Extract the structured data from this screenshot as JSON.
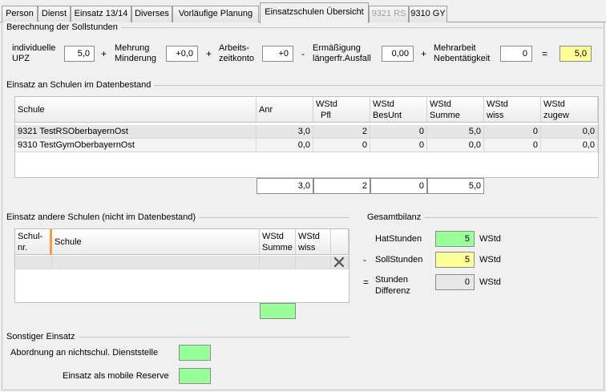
{
  "tabs": [
    {
      "label": "Person"
    },
    {
      "label": "Dienst"
    },
    {
      "label": "Einsatz 13/14"
    },
    {
      "label": "Diverses"
    },
    {
      "label": "Vorläufige Planung"
    },
    {
      "label": "Einsatzschulen Übersicht"
    },
    {
      "label": "9321 RS"
    },
    {
      "label": "9310 GY"
    }
  ],
  "soll": {
    "title": "Berechnung der Sollstunden",
    "upz_label_1": "individuelle",
    "upz_label_2": "UPZ",
    "upz_value": "5,0",
    "plus1": "+",
    "mehrung_label_1": "Mehrung",
    "mehrung_label_2": "Minderung",
    "mehrung_value": "+0,0",
    "plus2": "+",
    "arbeitszeit_label_1": "Arbeits-",
    "arbeitszeit_label_2": "zeitkonto",
    "arbeitszeit_value": "+0",
    "minus": "-",
    "ermaessigung_label_1": "Ermäßigung",
    "ermaessigung_label_2": "längerfr.Ausfall",
    "ermaessigung_value": "0,00",
    "plus3": "+",
    "mehrarbeit_label_1": "Mehrarbeit",
    "mehrarbeit_label_2": "Nebentätigkeit",
    "mehrarbeit_value": "0",
    "equals": "=",
    "result_value": "5,0"
  },
  "datenbestand": {
    "title": "Einsatz an Schulen im Datenbestand",
    "headers": {
      "schule": "Schule",
      "anr": "Anr",
      "pfl_1": "WStd",
      "pfl_2": "Pfl",
      "besunt_1": "WStd",
      "besunt_2": "BesUnt",
      "summe_1": "WStd",
      "summe_2": "Summe",
      "wiss_1": "WStd",
      "wiss_2": "wiss",
      "zugew_1": "WStd",
      "zugew_2": "zugew"
    },
    "rows": [
      {
        "schule": "9321 TestRSOberbayernOst",
        "anr": "3,0",
        "pfl": "2",
        "besunt": "0",
        "summe": "5,0",
        "wiss": "0",
        "zugew": "0,0"
      },
      {
        "schule": "9310 TestGymOberbayernOst",
        "anr": "0,0",
        "pfl": "0",
        "besunt": "0",
        "summe": "0,0",
        "wiss": "0",
        "zugew": "0,0"
      }
    ],
    "totals": {
      "anr": "3,0",
      "pfl": "2",
      "besunt": "0",
      "summe": "5,0"
    }
  },
  "andere": {
    "title": "Einsatz andere Schulen (nicht im Datenbestand)",
    "headers": {
      "nr_1": "Schul-",
      "nr_2": "nr.",
      "schule": "Schule",
      "summe_1": "WStd",
      "summe_2": "Summe",
      "wiss_1": "WStd",
      "wiss_2": "wiss"
    },
    "delete_icon": "close-icon",
    "total_summe": ""
  },
  "bilanz": {
    "title": "Gesamtbilanz",
    "hat_label": "HatStunden",
    "hat_value": "5",
    "hat_unit": "WStd",
    "minus": "-",
    "soll_label": "SollStunden",
    "soll_value": "5",
    "soll_unit": "WStd",
    "equals": "=",
    "diff_label_1": "Stunden",
    "diff_label_2": "Differenz",
    "diff_value": "0",
    "diff_unit": "WStd"
  },
  "sonstiger": {
    "title": "Sonstiger Einsatz",
    "abordnung_label": "Abordnung an nichtschul. Dienststelle",
    "abordnung_value": "",
    "reserve_label": "Einsatz als mobile Reserve",
    "reserve_value": ""
  },
  "colors": {
    "yellow": "#ffff99",
    "green": "#99ff99",
    "gray_field": "#e8e8e8"
  }
}
